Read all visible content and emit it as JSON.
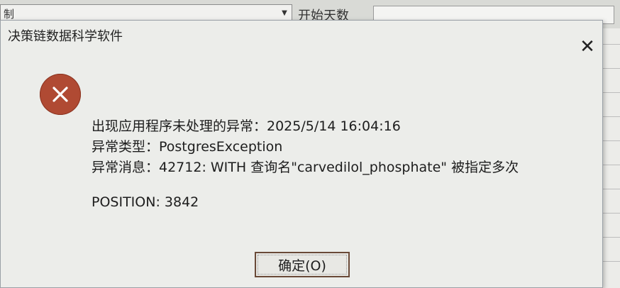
{
  "background": {
    "combo_text": "制",
    "label": "开始天数"
  },
  "dialog": {
    "title": "决策链数据科学软件",
    "close_glyph": "✕",
    "icon": "error-x-icon",
    "icon_color": "#b04a33",
    "message": {
      "line1": "出现应用程序未处理的异常：2025/5/14 16:04:16",
      "line2": "异常类型：PostgresException",
      "line3": "异常消息：42712: WITH 查询名\"carvedilol_phosphate\" 被指定多次",
      "line4": "POSITION: 3842"
    },
    "ok_label": "确定(O)"
  }
}
